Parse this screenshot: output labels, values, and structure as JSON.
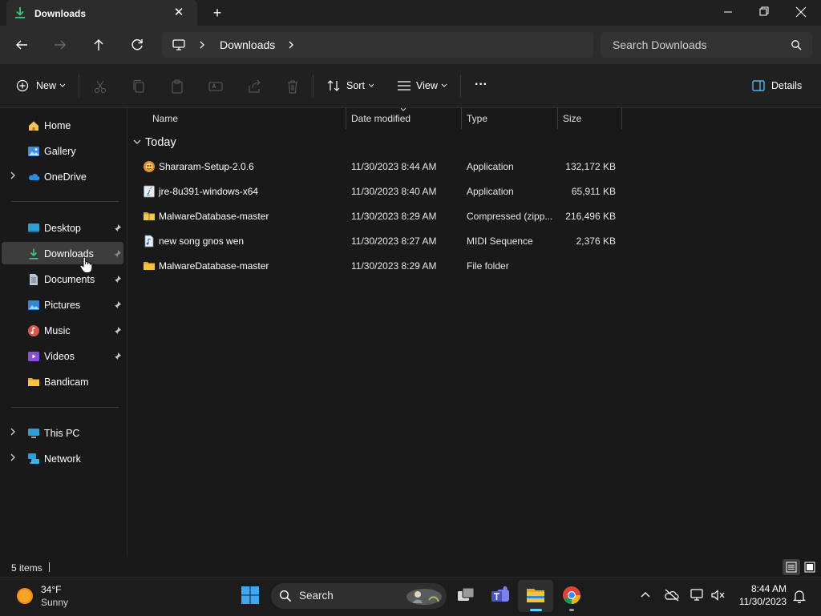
{
  "window": {
    "tab_title": "Downloads",
    "close_tab": "✕",
    "new_tab": "+"
  },
  "address": {
    "location": "Downloads",
    "search_placeholder": "Search Downloads"
  },
  "toolbar": {
    "new_label": "New",
    "sort_label": "Sort",
    "view_label": "View",
    "more_label": "···",
    "details_label": "Details"
  },
  "sidebar": {
    "items": [
      {
        "label": "Home"
      },
      {
        "label": "Gallery"
      },
      {
        "label": "OneDrive"
      },
      {
        "label": "Desktop"
      },
      {
        "label": "Downloads"
      },
      {
        "label": "Documents"
      },
      {
        "label": "Pictures"
      },
      {
        "label": "Music"
      },
      {
        "label": "Videos"
      },
      {
        "label": "Bandicam"
      },
      {
        "label": "This PC"
      },
      {
        "label": "Network"
      }
    ]
  },
  "table": {
    "columns": [
      "Name",
      "Date modified",
      "Type",
      "Size"
    ],
    "group_label": "Today",
    "rows": [
      {
        "name": "Shararam-Setup-2.0.6",
        "date": "11/30/2023 8:44 AM",
        "type": "Application",
        "size": "132,172 KB"
      },
      {
        "name": "jre-8u391-windows-x64",
        "date": "11/30/2023 8:40 AM",
        "type": "Application",
        "size": "65,911 KB"
      },
      {
        "name": "MalwareDatabase-master",
        "date": "11/30/2023 8:29 AM",
        "type": "Compressed (zipp...",
        "size": "216,496 KB"
      },
      {
        "name": "new song gnos wen",
        "date": "11/30/2023 8:27 AM",
        "type": "MIDI Sequence",
        "size": "2,376 KB"
      },
      {
        "name": "MalwareDatabase-master",
        "date": "11/30/2023 8:29 AM",
        "type": "File folder",
        "size": ""
      }
    ]
  },
  "status": {
    "item_count": "5 items"
  },
  "taskbar": {
    "weather_temp": "34°F",
    "weather_desc": "Sunny",
    "search_label": "Search",
    "time": "8:44 AM",
    "date": "11/30/2023"
  },
  "colors": {
    "accent": "#60cdff",
    "folder": "#f4c33f",
    "selected": "#3d3d3d"
  }
}
